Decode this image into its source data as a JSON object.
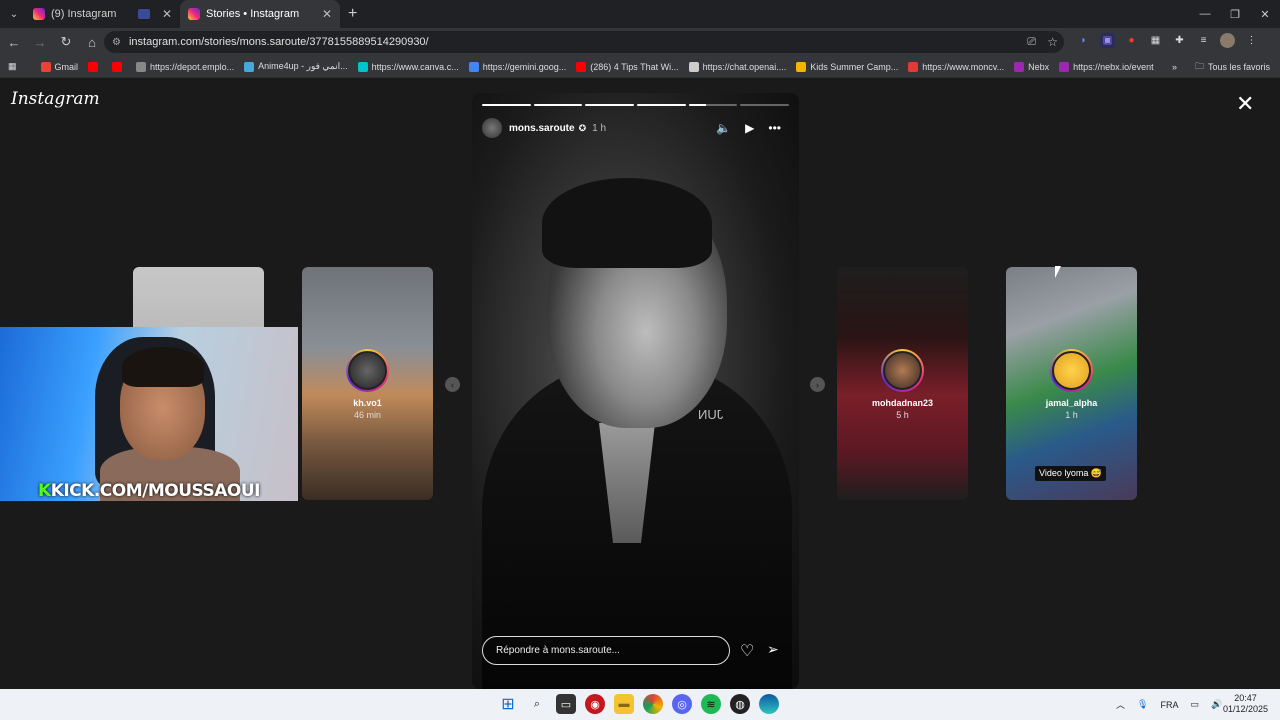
{
  "browser": {
    "tabs": [
      {
        "title": "(9) Instagram"
      },
      {
        "title": "Stories • Instagram"
      }
    ],
    "url": "instagram.com/stories/mons.saroute/3778155889514290930/",
    "bookmarks": [
      {
        "label": "Gmail",
        "color": "#ea4335"
      },
      {
        "label": "",
        "color": "#ff0000"
      },
      {
        "label": "",
        "color": "#ff0000"
      },
      {
        "label": "https://depot.emplo...",
        "color": "#888888"
      },
      {
        "label": "Anime4up - انمي فور...",
        "color": "#44aadd"
      },
      {
        "label": "https://www.canva.c...",
        "color": "#00c4cc"
      },
      {
        "label": "https://gemini.goog...",
        "color": "#4285f4"
      },
      {
        "label": "(286) 4 Tips That Wi...",
        "color": "#ff0000"
      },
      {
        "label": "https://chat.openai....",
        "color": "#cccccc"
      },
      {
        "label": "Kids Summer Camp...",
        "color": "#f4b400"
      },
      {
        "label": "https://www.moncv...",
        "color": "#e53935"
      },
      {
        "label": "Nebx",
        "color": "#9c27b0"
      },
      {
        "label": "https://nebx.io/event",
        "color": "#9c27b0"
      }
    ],
    "bookmarks_all": "Tous les favoris"
  },
  "instagram": {
    "logo": "Instagram",
    "main_story": {
      "username": "mons.saroute",
      "time": "1 h",
      "overlay_text": "JUN",
      "reply_placeholder": "Répondre à mons.saroute...",
      "progress": [
        1,
        1,
        1,
        1,
        0.35,
        0
      ]
    },
    "side_stories": [
      {
        "username": "",
        "time": ""
      },
      {
        "username": "kh.vo1",
        "time": "46 min"
      },
      {
        "username": "mohdadnan23",
        "time": "5 h"
      },
      {
        "username": "jamal_alpha",
        "time": "1 h",
        "caption": "Video lyoma 😅"
      }
    ]
  },
  "webcam": {
    "overlay_k": "K",
    "overlay_text": "KICK.COM/MOUSSAOUI"
  },
  "taskbar": {
    "language": "FRA",
    "time": "20:47",
    "date": "01/12/2025"
  },
  "colors": {
    "accent_kick": "#53fc18",
    "story_ring": "#ee2a7b"
  }
}
